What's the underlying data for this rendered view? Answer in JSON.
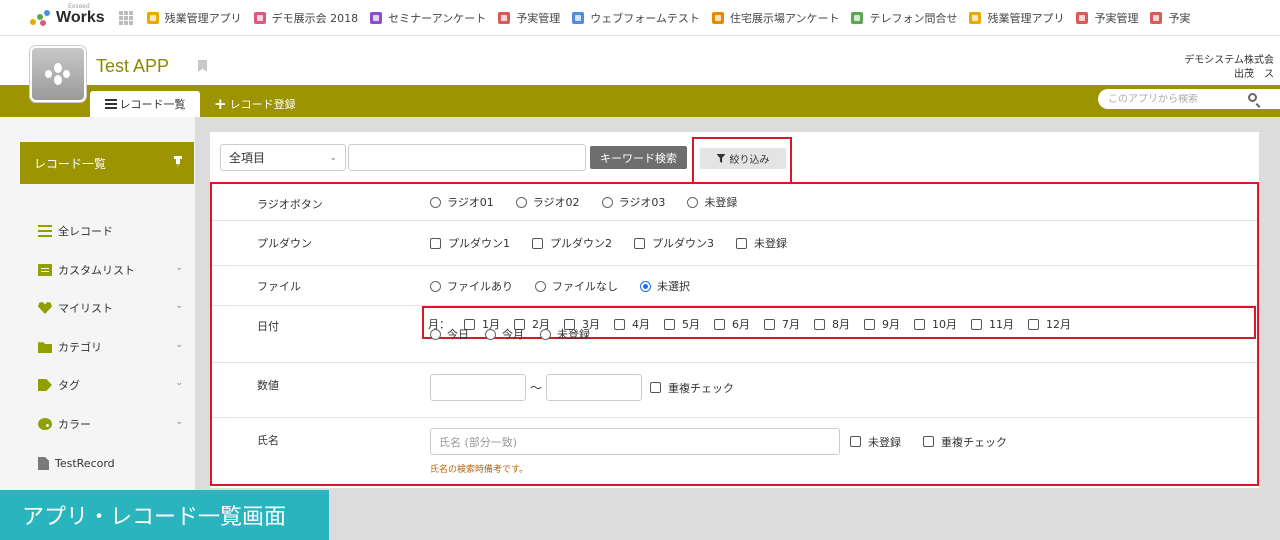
{
  "topbar": {
    "logo_text": "Works",
    "logo_sub": "Exseed",
    "bookmarks": [
      {
        "label": "残業管理アプリ",
        "color": "#e8a900"
      },
      {
        "label": "デモ展示会 2018",
        "color": "#d95a85"
      },
      {
        "label": "セミナーアンケート",
        "color": "#8a4fc7"
      },
      {
        "label": "予実管理",
        "color": "#d95a5a"
      },
      {
        "label": "ウェブフォームテスト",
        "color": "#4f8fd9"
      },
      {
        "label": "住宅展示場アンケート",
        "color": "#e88a00"
      },
      {
        "label": "テレフォン問合せ",
        "color": "#5aa84f"
      },
      {
        "label": "残業管理アプリ",
        "color": "#e8a900"
      },
      {
        "label": "予実管理",
        "color": "#d95a5a"
      },
      {
        "label": "予実",
        "color": "#d95a5a"
      }
    ]
  },
  "app": {
    "title": "Test APP",
    "company_line1": "デモシステム株式会",
    "company_line2": "出茂　ス"
  },
  "nav": {
    "tab_list": "レコード一覧",
    "tab_register": "レコード登録",
    "search_placeholder": "このアプリから検索"
  },
  "sidebar": {
    "header": "レコード一覧",
    "items": [
      {
        "label": "全レコード"
      },
      {
        "label": "カスタムリスト"
      },
      {
        "label": "マイリスト"
      },
      {
        "label": "カテゴリ"
      },
      {
        "label": "タグ"
      },
      {
        "label": "カラー"
      },
      {
        "label": "TestRecord"
      }
    ]
  },
  "search": {
    "field_select": "全項目",
    "keyword_button": "キーワード検索",
    "filter_button": "絞り込み"
  },
  "filters": {
    "radio": {
      "label": "ラジオボタン",
      "options": [
        "ラジオ01",
        "ラジオ02",
        "ラジオ03",
        "未登録"
      ]
    },
    "dropdown": {
      "label": "プルダウン",
      "options": [
        "プルダウン1",
        "プルダウン2",
        "プルダウン3",
        "未登録"
      ]
    },
    "file": {
      "label": "ファイル",
      "options": [
        "ファイルあり",
        "ファイルなし",
        "未選択"
      ],
      "selected": "未選択"
    },
    "date": {
      "label": "日付",
      "month_label": "月：",
      "months": [
        "1月",
        "2月",
        "3月",
        "4月",
        "5月",
        "6月",
        "7月",
        "8月",
        "9月",
        "10月",
        "11月",
        "12月"
      ],
      "extra": [
        "今日",
        "今月",
        "未登録"
      ]
    },
    "number": {
      "label": "数値",
      "tilde": "～",
      "dup_check": "重複チェック"
    },
    "name": {
      "label": "氏名",
      "placeholder": "氏名 (部分一致)",
      "unregistered": "未登録",
      "dup_check": "重複チェック",
      "note": "氏名の検索時備考です。"
    }
  },
  "caption": "アプリ・レコード一覧画面"
}
